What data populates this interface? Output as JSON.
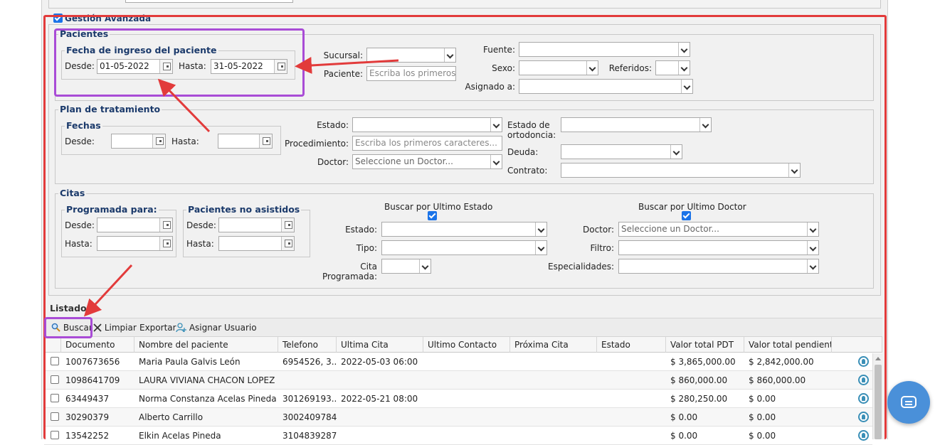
{
  "colors": {
    "annotation_red": "#e23b3b",
    "annotation_purple": "#a94cd6",
    "legend_blue": "#1b3a6b",
    "checkbox_blue": "#1a73e8",
    "chat_blue": "#4a90d9"
  },
  "gestion": {
    "label": "Gestión Avanzada",
    "checked": true
  },
  "pacientes": {
    "legend": "Pacientes",
    "fecha_ingreso": {
      "legend": "Fecha de ingreso del paciente",
      "desde_label": "Desde:",
      "desde_value": "01-05-2022",
      "hasta_label": "Hasta:",
      "hasta_value": "31-05-2022"
    },
    "sucursal_label": "Sucursal:",
    "sucursal_value": "",
    "paciente_label": "Paciente:",
    "paciente_placeholder": "Escriba los primeros caracteres...",
    "fuente_label": "Fuente:",
    "sexo_label": "Sexo:",
    "referidos_label": "Referidos:",
    "asignado_label": "Asignado a:"
  },
  "plan": {
    "legend": "Plan de tratamiento",
    "fechas": {
      "legend": "Fechas",
      "desde_label": "Desde:",
      "hasta_label": "Hasta:"
    },
    "estado_label": "Estado:",
    "procedimiento_label": "Procedimiento:",
    "procedimiento_placeholder": "Escriba los primeros caracteres...",
    "doctor_label": "Doctor:",
    "doctor_placeholder": "Seleccione un Doctor...",
    "estado_ortodoncia_label_1": "Estado de",
    "estado_ortodoncia_label_2": "ortodoncia:",
    "deuda_label": "Deuda:",
    "contrato_label": "Contrato:"
  },
  "citas": {
    "legend": "Citas",
    "programada": {
      "legend": "Programada para:",
      "desde_label": "Desde:",
      "hasta_label": "Hasta:"
    },
    "no_asistidos": {
      "legend": "Pacientes no asistidos",
      "desde_label": "Desde:",
      "hasta_label": "Hasta:"
    },
    "buscar_ultimo_estado": "Buscar por Ultimo Estado",
    "buscar_ultimo_doctor": "Buscar por Ultimo Doctor",
    "estado_label": "Estado:",
    "tipo_label": "Tipo:",
    "cita_programada_label_1": "Cita",
    "cita_programada_label_2": "Programada:",
    "doctor_label": "Doctor:",
    "doctor_placeholder": "Seleccione un Doctor...",
    "filtro_label": "Filtro:",
    "especialidades_label": "Especialidades:"
  },
  "listado": {
    "title": "Listado",
    "toolbar": {
      "buscar": "Buscar",
      "limpiar": "Limpiar",
      "exportar": "Exportar",
      "asignar": "Asignar Usuario"
    },
    "columns": [
      "Documento",
      "Nombre del paciente",
      "Telefono",
      "Ultima Cita",
      "Ultimo Contacto",
      "Próxima Cita",
      "Estado",
      "Valor total PDT",
      "Valor total pendiente"
    ],
    "rows": [
      {
        "documento": "1007673656",
        "nombre": "Maria Paula Galvis León",
        "telefono": "6954526, 3...",
        "ultima_cita": "2022-05-03 06:00",
        "ultimo_contacto": "",
        "proxima_cita": "",
        "estado": "",
        "valor_pdt": "$ 3,865,000.00",
        "valor_pendiente": "$ 2,842,000.00"
      },
      {
        "documento": "1098641709",
        "nombre": "LAURA VIVIANA CHACON LOPEZ",
        "telefono": "",
        "ultima_cita": "",
        "ultimo_contacto": "",
        "proxima_cita": "",
        "estado": "",
        "valor_pdt": "$ 860,000.00",
        "valor_pendiente": "$ 860,000.00"
      },
      {
        "documento": "63449437",
        "nombre": "Norma Constanza Acelas Pineda",
        "telefono": "301269193...",
        "ultima_cita": "2022-05-21 08:00",
        "ultimo_contacto": "",
        "proxima_cita": "",
        "estado": "",
        "valor_pdt": "$ 280,250.00",
        "valor_pendiente": "$ 0.00"
      },
      {
        "documento": "30290379",
        "nombre": "Alberto Carrillo",
        "telefono": "3002409784,",
        "ultima_cita": "",
        "ultimo_contacto": "",
        "proxima_cita": "",
        "estado": "",
        "valor_pdt": "$ 0.00",
        "valor_pendiente": "$ 0.00"
      },
      {
        "documento": "13542252",
        "nombre": "Elkin Acelas Pineda",
        "telefono": "3104839287,",
        "ultima_cita": "",
        "ultimo_contacto": "",
        "proxima_cita": "",
        "estado": "",
        "valor_pdt": "$ 0.00",
        "valor_pendiente": "$ 0.00"
      }
    ]
  }
}
